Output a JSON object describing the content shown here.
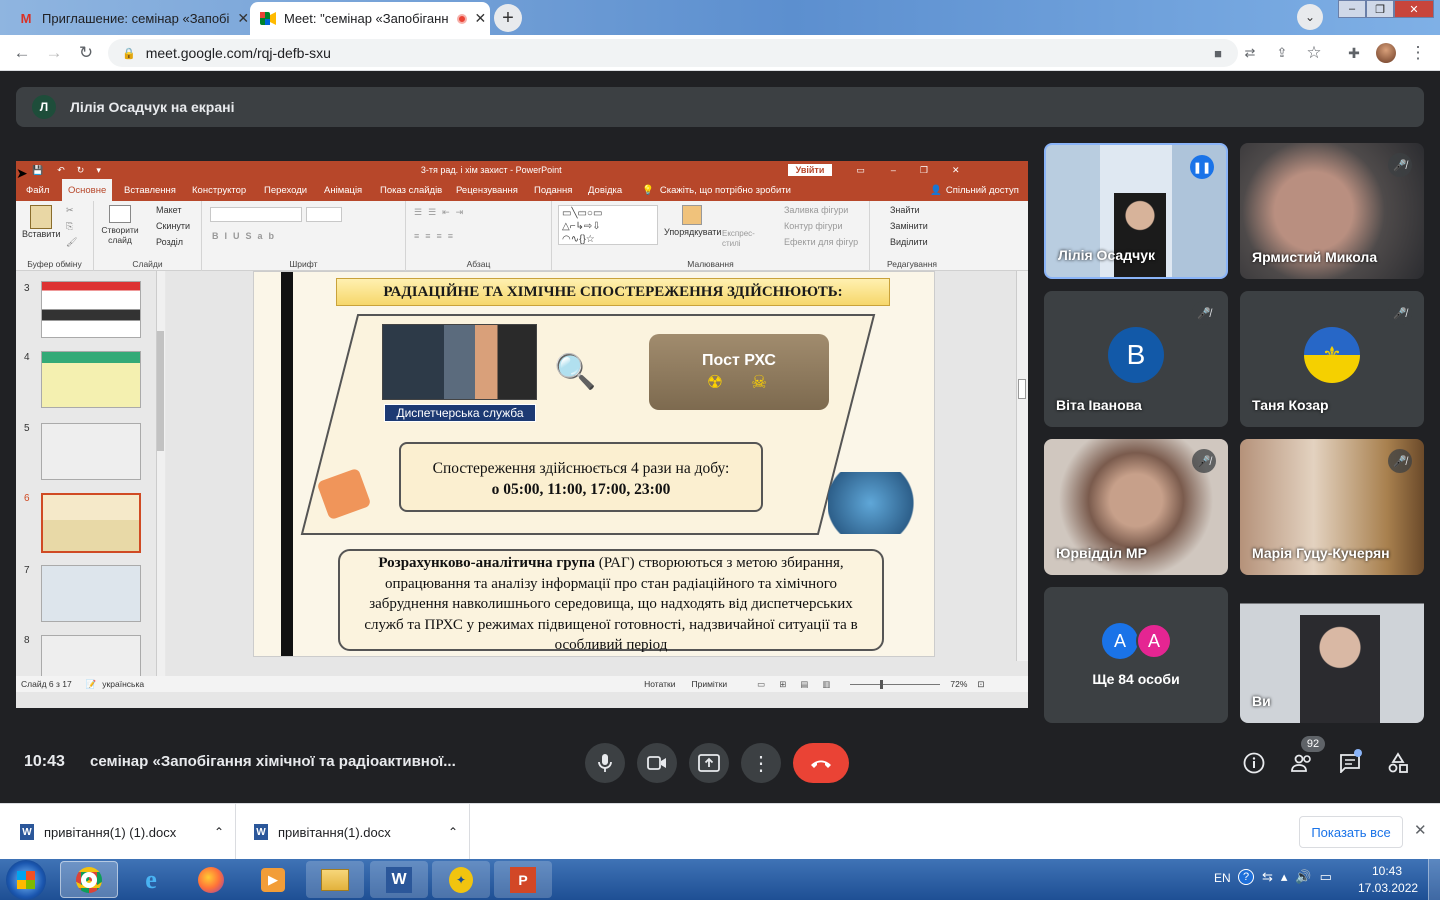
{
  "browser": {
    "tabs": [
      {
        "title": "Приглашение: семінар «Запобі",
        "active": false
      },
      {
        "title": "Meet: \"семінар «Запобіганн",
        "active": true
      }
    ],
    "url": "meet.google.com/rqj-defb-sxu"
  },
  "meet": {
    "presenter_initial": "Л",
    "presenter_banner": "Лілія Осадчук на екрані",
    "time": "10:43",
    "meeting_title": "семінар «Запобігання хімічної та радіоактивної...",
    "participants_count": "92",
    "tiles": [
      {
        "name": "Лілія Осадчук",
        "speaking": true
      },
      {
        "name": "Ярмистий Микола",
        "muted": true
      },
      {
        "name": "Віта Іванова",
        "initial": "В",
        "muted": true
      },
      {
        "name": "Таня Козар",
        "muted": true
      },
      {
        "name": "Юрвідділ МР",
        "muted": true
      },
      {
        "name": "Марія Гуцу-Кучерян",
        "muted": true
      },
      {
        "name": "Ще 84 особи",
        "initials": [
          "А",
          "А"
        ]
      },
      {
        "name": "Ви"
      }
    ]
  },
  "powerpoint": {
    "window_title": "3-тя рад. і хім захист - PowerPoint",
    "signin": "Увійти",
    "tabs": [
      "Файл",
      "Основне",
      "Вставлення",
      "Конструктор",
      "Переходи",
      "Анімація",
      "Показ слайдів",
      "Рецензування",
      "Подання",
      "Довідка"
    ],
    "tell_me": "Скажіть, що потрібно зробити",
    "share": "Спільний доступ",
    "groups": {
      "clipboard": "Буфер обміну",
      "paste": "Вставити",
      "slides": "Слайди",
      "new_slide": "Створити слайд",
      "layout": "Макет",
      "reset": "Скинути",
      "section": "Розділ",
      "font": "Шрифт",
      "paragraph": "Абзац",
      "drawing": "Малювання",
      "arrange": "Упорядкувати",
      "quick_styles": "Експрес-стилі",
      "fill": "Заливка фігури",
      "outline": "Контур фігури",
      "effects": "Ефекти для фігур",
      "editing": "Редагування",
      "find": "Знайти",
      "replace": "Замінити",
      "select": "Виділити"
    },
    "thumbnails": [
      "3",
      "4",
      "5",
      "6",
      "7",
      "8"
    ],
    "selected_slide": "6",
    "status": {
      "slide_info": "Слайд 6 з 17",
      "language": "українська",
      "notes": "Нотатки",
      "comments": "Примітки",
      "zoom": "72%"
    },
    "slide": {
      "title": "РАДІАЦІЙНЕ ТА ХІМІЧНЕ СПОСТЕРЕЖЕННЯ ЗДІЙСНЮЮТЬ:",
      "dispatch_label": "Диспетчерська служба",
      "post_label": "Пост РХС",
      "observation_line1": "Спостереження здійснюється 4 рази на добу:",
      "observation_line2": "о 05:00, 11:00, 17:00, 23:00",
      "rag_bold": "Розрахунково-аналітична група",
      "rag_text": " (РАГ) створюються з метою збирання, опрацювання та аналізу інформації про стан радіаційного та хімічного забруднення навколишнього середовища, що надходять від диспетчерських служб та ПРХС у режимах підвищеної готовності, надзвичайної ситуації та в особливий період"
    }
  },
  "downloads": {
    "items": [
      "привітання(1) (1).docx",
      "привітання(1).docx"
    ],
    "show_all": "Показать все"
  },
  "taskbar": {
    "lang": "EN",
    "time": "10:43",
    "date": "17.03.2022"
  },
  "colors": {
    "meet_bg": "#202124",
    "tile_bg": "#3c4043",
    "hangup": "#ea4335",
    "ppt_accent": "#b7472a"
  }
}
